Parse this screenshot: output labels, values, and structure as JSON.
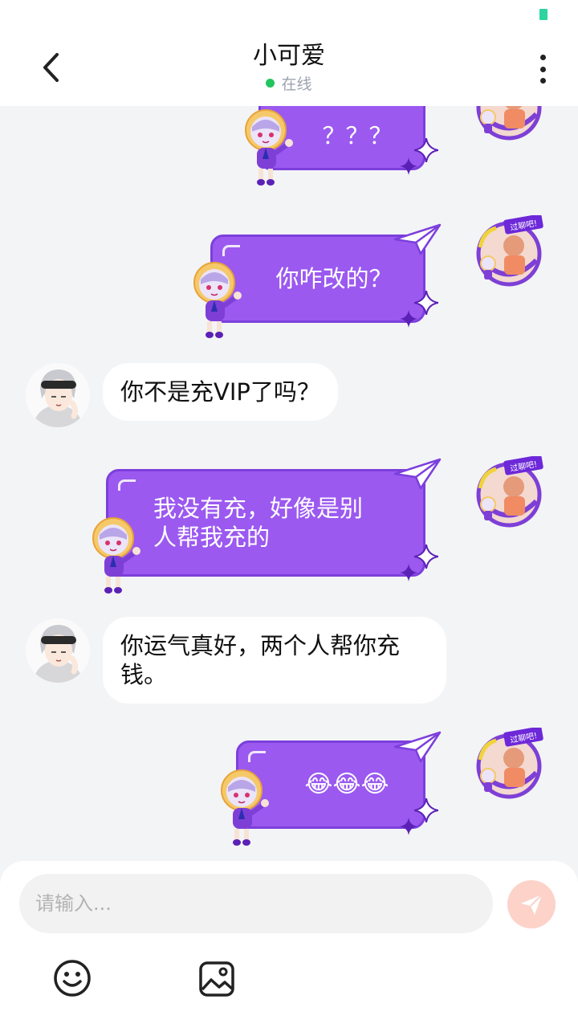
{
  "header": {
    "title": "小可爱",
    "status_text": "在线",
    "status_color": "#22c55e"
  },
  "messages": [
    {
      "side": "right",
      "text": "？？？"
    },
    {
      "side": "right",
      "text": "你咋改的？"
    },
    {
      "side": "left",
      "text": "你不是充VIP了吗？"
    },
    {
      "side": "right",
      "text": "我没有充，好像是别人帮我充的"
    },
    {
      "side": "left",
      "text": "你运气真好，两个人帮你充钱。"
    },
    {
      "side": "right",
      "text": "😂😂😂"
    }
  ],
  "input": {
    "placeholder": "请输入..."
  },
  "icons": {
    "back": "chevron-left-icon",
    "more": "more-vertical-icon",
    "send": "paper-plane-icon",
    "emoji": "smiley-icon",
    "image": "image-icon"
  },
  "colors": {
    "bubble_purple": "#9b59f0",
    "bubble_border": "#7c3fdc",
    "send_button": "#fcd2c9"
  }
}
